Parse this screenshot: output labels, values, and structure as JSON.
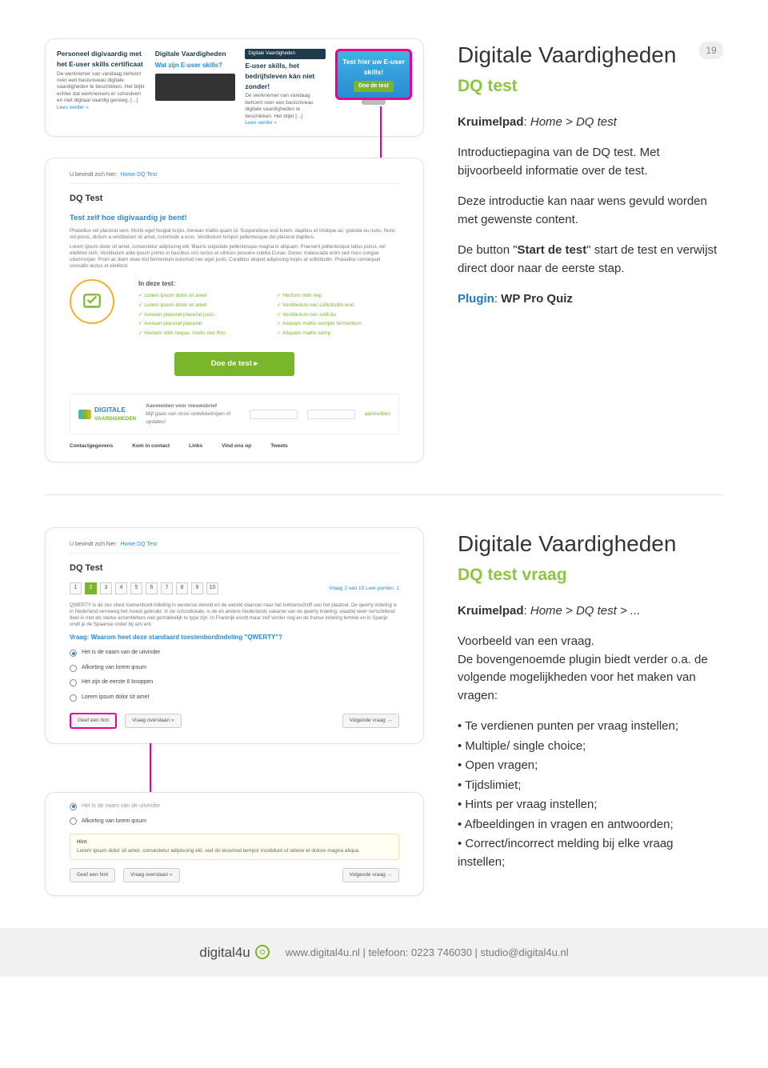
{
  "page_number": "19",
  "section1": {
    "title": "Digitale Vaardigheden",
    "subtitle": "DQ test",
    "crumb_label": "Kruimelpad",
    "crumb_value": "Home > DQ test",
    "p1": "Introductiepagina van de DQ test. Met bijvoorbeeld informatie over de test.",
    "p2": "Deze introductie kan naar wens gevuld worden met gewenste content.",
    "p3a": "De button \"",
    "p3b": "Start de test",
    "p3c": "\" start de test en verwijst direct door naar de eerste stap.",
    "plugin_label": "Plugin",
    "plugin_value": "WP Pro Quiz"
  },
  "section2": {
    "title": "Digitale Vaardigheden",
    "subtitle": "DQ test vraag",
    "crumb_label": "Kruimelpad",
    "crumb_value": "Home > DQ test > ...",
    "p1": "Voorbeeld van een vraag.",
    "p2": "De bovengenoemde plugin biedt verder o.a. de volgende mogelijkheden voor het maken van vragen:",
    "features": [
      "Te verdienen punten per vraag instellen;",
      "Multiple/ single choice;",
      "Open vragen;",
      "Tijdslimiet;",
      "Hints per vraag instellen;",
      "Afbeeldingen in vragen en antwoorden;",
      "Correct/incorrect melding bij elke vraag instellen;"
    ]
  },
  "promo": {
    "col1_title": "Personeel digivaardig met het E-user skills certificaat",
    "col1_txt": "De werknemer van vandaag behoort over een basisniveau digitale vaardigheden te beschikken. Het blijkt echter dat werknemers er schoolverl en niet digitaal vaardig genoeg. [...]",
    "col1_more": "Lees verder »",
    "col2_title": "Digitale Vaardigheden",
    "col2_sub": "Wat zijn E-user skills?",
    "col3_title": "E-user skills, het bedrijfsleven kán niet zonder!",
    "col3_txt": "De werknemer van vandaag behoort over een basisniveau digitale vaardigheden te beschikken. Het blijkt [...]",
    "col3_more": "Lees verder »",
    "tv_line": "Test hier uw E-user skills!",
    "tv_btn": "Doe de test"
  },
  "dqpage": {
    "crumb_lead": "U bevindt zich hier:",
    "crumb": "Home   DQ Test",
    "h": "DQ Test",
    "h2": "Test zelf hoe digivaardig je bent!",
    "lorem1": "Phasellus vel placerat sem. Morbi eget feugiat turpis. Aenean mattis quam id. Suspendisse erat lorem, dapibus et tristique ac, gravida eu nunc. Nunc vid purus, dictum a vestibulum sit amet, commodo a eros. Vestibulum tempor pellentesque dui placerat dapibus.",
    "lorem2": "Lorem ipsum dolor sit amet, consectetur adipiscing elit. Mauris vulputate pellentesque magna in aliquam. Praesent pellentesque tellus purus, vel eleifend nish. Vestibulum ante ipsum primis in faucibus orci luctus et ultrices posuere cubilia Curae; Donec malesuada enim sed risus congue ullamcorper. Proin ac diam vitae nisl fermentum euismod nec eget justo. Curabitur aliquet adipiscing turpis at sollicitudin. Phasellus consequat convallis lectus et eleifend.",
    "in_test": "In deze test:",
    "feat": [
      "Lorem ipsum dolor sit amet",
      "Aenean placerat placerat justo",
      "Hectum nibh neque, mollis nec fhin.",
      "Vestibulum nec sollicitudin erat.",
      "Aliquam mattis semper fermentum",
      "Lorem ipsum dolor sit amet",
      "Aenean placerat placerat",
      "Hectum nibh nep",
      "Vestibulum nec sollicitu",
      "Aliquam mattis semp"
    ],
    "btn": "Doe de test   ▸",
    "news_lbl": "Aanmelden voor nieuwsbrief",
    "news_sub": "blijf gaan van onze ontwikkelingen of updates!",
    "news_btn": "aanmelden",
    "brand1": "DIGITALE",
    "brand2": "VAARDIGHEDEN",
    "footlinks": [
      "Contactgegevens",
      "Kom in contact",
      "Links",
      "Vind ons op",
      "Tweets"
    ]
  },
  "question": {
    "crumb_lead": "U bevindt zich hier:",
    "crumb": "Home   DQ Test",
    "h": "DQ Test",
    "pages": [
      "1",
      "2",
      "3",
      "4",
      "5",
      "6",
      "7",
      "8",
      "9",
      "10"
    ],
    "pager_meta": "Vraag 2 van 10      Leer punten: 1",
    "lorem": "QWERTY is de zes vliest toetsenbord indeling in westerse wereld en de wereld daarvan naar het toetsenschrift van het plaatsel. De qwerty indeling is in Nederland verreweg het meest gebruikt. In de schoollokale, is de en andere Nederlands vakante van de qwerty indeling, waarbij weer verschillend deel in met als sterke accentletters niet gemakkelijk te type zijn. In Frankrijk wordt maar zelf verder nog en de franse indeling temrek en in Spanje vindt je de Spaanse onder bij azv ent.",
    "q": "Vraag: Waarom heet deze standaard toestenbordindeling \"QWERTY\"?",
    "opts": [
      "Het is de naam van de uitvinder",
      "Afkorting van lorem ipsum",
      "Het zijn de eerste 6 knoppen",
      "Lorem ipsum dolor sit amet"
    ],
    "hint_btn": "Geef een hint",
    "skip_btn": "Vraag overslaan »",
    "next_btn": "Volgende vraag →"
  },
  "hint": {
    "opt_above": "Het is de naam van de uitvinder",
    "opt_sel": "Afkorting van lorem ipsum",
    "title": "Hint",
    "txt": "Lorem ipsum dolor sit amet, consectetur adipiscing elit, sed do eiusmod tempor incididunt ut labore et dolore magna aliqua.",
    "hint_btn": "Geef een hint",
    "skip_btn": "Vraag overslaan »",
    "next_btn": "Volgende vraag →"
  },
  "footer": {
    "brand": "digital4u",
    "text": "www.digital4u.nl   |   telefoon: 0223 746030   |   studio@digital4u.nl"
  }
}
